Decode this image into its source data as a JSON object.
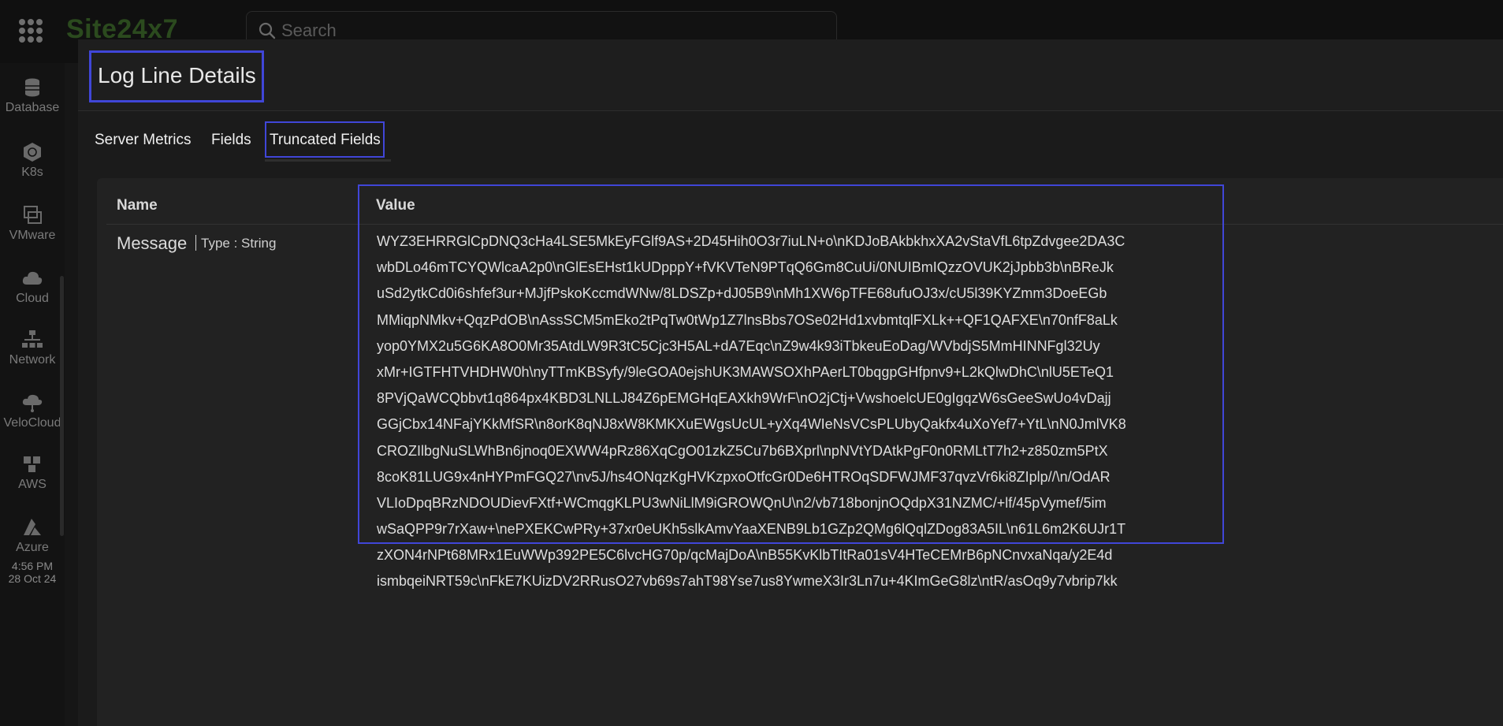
{
  "app": {
    "brand": "Site24x7",
    "search_placeholder": "Search"
  },
  "sidebar": {
    "items": [
      {
        "label": "Database",
        "icon": "database-icon"
      },
      {
        "label": "K8s",
        "icon": "kubernetes-icon"
      },
      {
        "label": "VMware",
        "icon": "vmware-icon"
      },
      {
        "label": "Cloud",
        "icon": "cloud-icon"
      },
      {
        "label": "Network",
        "icon": "network-icon"
      },
      {
        "label": "VeloCloud",
        "icon": "velocloud-icon"
      },
      {
        "label": "AWS",
        "icon": "aws-icon"
      },
      {
        "label": "Azure",
        "icon": "azure-icon"
      }
    ],
    "clock_time": "4:56 PM",
    "clock_date": "28 Oct 24"
  },
  "modal": {
    "title": "Log Line Details",
    "tabs": [
      {
        "label": "Server Metrics"
      },
      {
        "label": "Fields"
      },
      {
        "label": "Truncated Fields"
      }
    ],
    "active_tab": "Truncated Fields",
    "table": {
      "columns": [
        "Name",
        "Value"
      ],
      "row": {
        "name": "Message",
        "type_label": "Type : String",
        "value_lines": [
          "WYZ3EHRRGlCpDNQ3cHa4LSE5MkEyFGlf9AS+2D45Hih0O3r7iuLN+o\\nKDJoBAkbkhxXA2vStaVfL6tpZdvgee2DA3C",
          "wbDLo46mTCYQWlcaA2p0\\nGlEsEHst1kUDpppY+fVKVTeN9PTqQ6Gm8CuUi/0NUIBmIQzzOVUK2jJpbb3b\\nBReJk",
          "uSd2ytkCd0i6shfef3ur+MJjfPskoKccmdWNw/8LDSZp+dJ05B9\\nMh1XW6pTFE68ufuOJ3x/cU5l39KYZmm3DoeEGb",
          "MMiqpNMkv+QqzPdOB\\nAssSCM5mEko2tPqTw0tWp1Z7lnsBbs7OSe02Hd1xvbmtqlFXLk++QF1QAFXE\\n70nfF8aLk",
          "yop0YMX2u5G6KA8O0Mr35AtdLW9R3tC5Cjc3H5AL+dA7Eqc\\nZ9w4k93iTbkeuEoDag/WVbdjS5MmHINNFgl32Uy",
          "xMr+IGTFHTVHDHW0h\\nyTTmKBSyfy/9leGOA0ejshUK3MAWSOXhPAerLT0bqgpGHfpnv9+L2kQlwDhC\\nlU5ETeQ1",
          "8PVjQaWCQbbvt1q864px4KBD3LNLLJ84Z6pEMGHqEAXkh9WrF\\nO2jCtj+VwshoelcUE0gIgqzW6sGeeSwUo4vDajj",
          "GGjCbx14NFajYKkMfSR\\n8orK8qNJ8xW8KMKXuEWgsUcUL+yXq4WIeNsVCsPLUbyQakfx4uXoYef7+YtL\\nN0JmlVK8",
          "CROZIlbgNuSLWhBn6jnoq0EXWW4pRz86XqCgO01zkZ5Cu7b6BXprl\\npNVtYDAtkPgF0n0RMLtT7h2+z850zm5PtX",
          "8coK81LUG9x4nHYPmFGQ27\\nv5J/hs4ONqzKgHVKzpxoOtfcGr0De6HTROqSDFWJMF37qvzVr6ki8ZIplp//\\n/OdAR",
          "VLIoDpqBRzNDOUDievFXtf+WCmqgKLPU3wNiLlM9iGROWQnU\\n2/vb718bonjnOQdpX31NZMC/+lf/45pVymef/5im",
          "wSaQPP9r7rXaw+\\nePXEKCwPRy+37xr0eUKh5slkAmvYaaXENB9Lb1GZp2QMg6lQqlZDog83A5IL\\n61L6m2K6UJr1T",
          "zXON4rNPt68MRx1EuWWp392PE5C6lvcHG70p/qcMajDoA\\nB55KvKlbTItRa01sV4HTeCEMrB6pNCnvxaNqa/y2E4d",
          "ismbqeiNRT59c\\nFkE7KUizDV2RRusO27vb69s7ahT98Yse7us8YwmeX3Ir3Ln7u+4KImGeG8lz\\ntR/asOq9y7vbrip7kk"
        ]
      }
    }
  },
  "colors": {
    "highlight": "#4046d8",
    "background": "#161616",
    "panel": "#222222"
  }
}
